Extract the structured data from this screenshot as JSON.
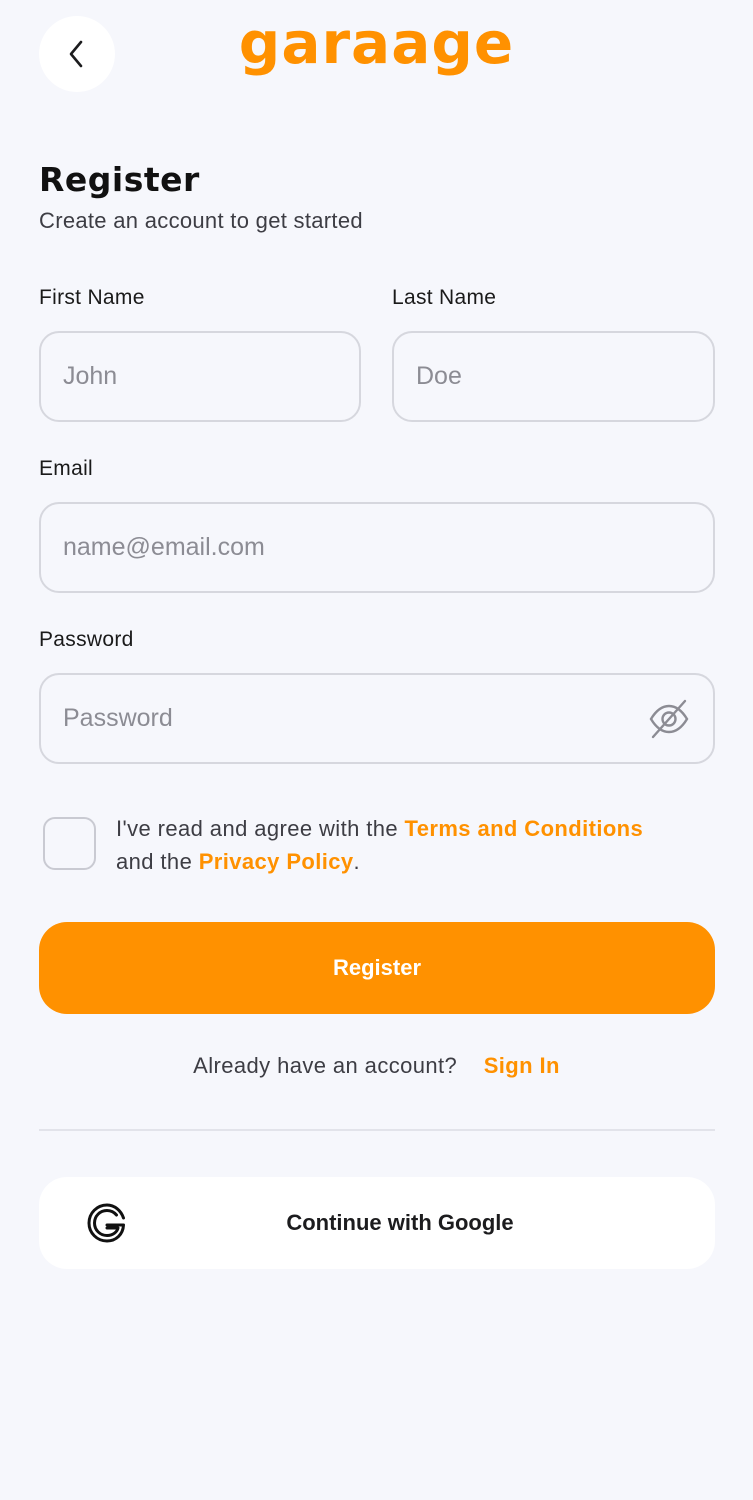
{
  "header": {
    "logo_text": "garaage",
    "back_icon": "chevron-left-icon"
  },
  "colors": {
    "accent": "#ff9100",
    "background": "#f6f7fc",
    "border": "#d6d7de"
  },
  "form": {
    "title": "Register",
    "subtitle": "Create an account to get started",
    "first_name": {
      "label": "First Name",
      "placeholder": "John",
      "value": ""
    },
    "last_name": {
      "label": "Last Name",
      "placeholder": "Doe",
      "value": ""
    },
    "email": {
      "label": "Email",
      "placeholder": "name@email.com",
      "value": ""
    },
    "password": {
      "label": "Password",
      "placeholder": "Password",
      "value": "",
      "toggle_icon": "eye-off-icon"
    },
    "agreement": {
      "checked": false,
      "text_before": "I've read and agree with the ",
      "terms_link": "Terms and Conditions",
      "text_middle": " and the ",
      "privacy_link": "Privacy Policy",
      "text_after": "."
    },
    "register_button": "Register",
    "signin_prompt": "Already have an account?",
    "signin_link": "Sign In",
    "google_button": "Continue with Google",
    "google_icon": "google-icon"
  }
}
